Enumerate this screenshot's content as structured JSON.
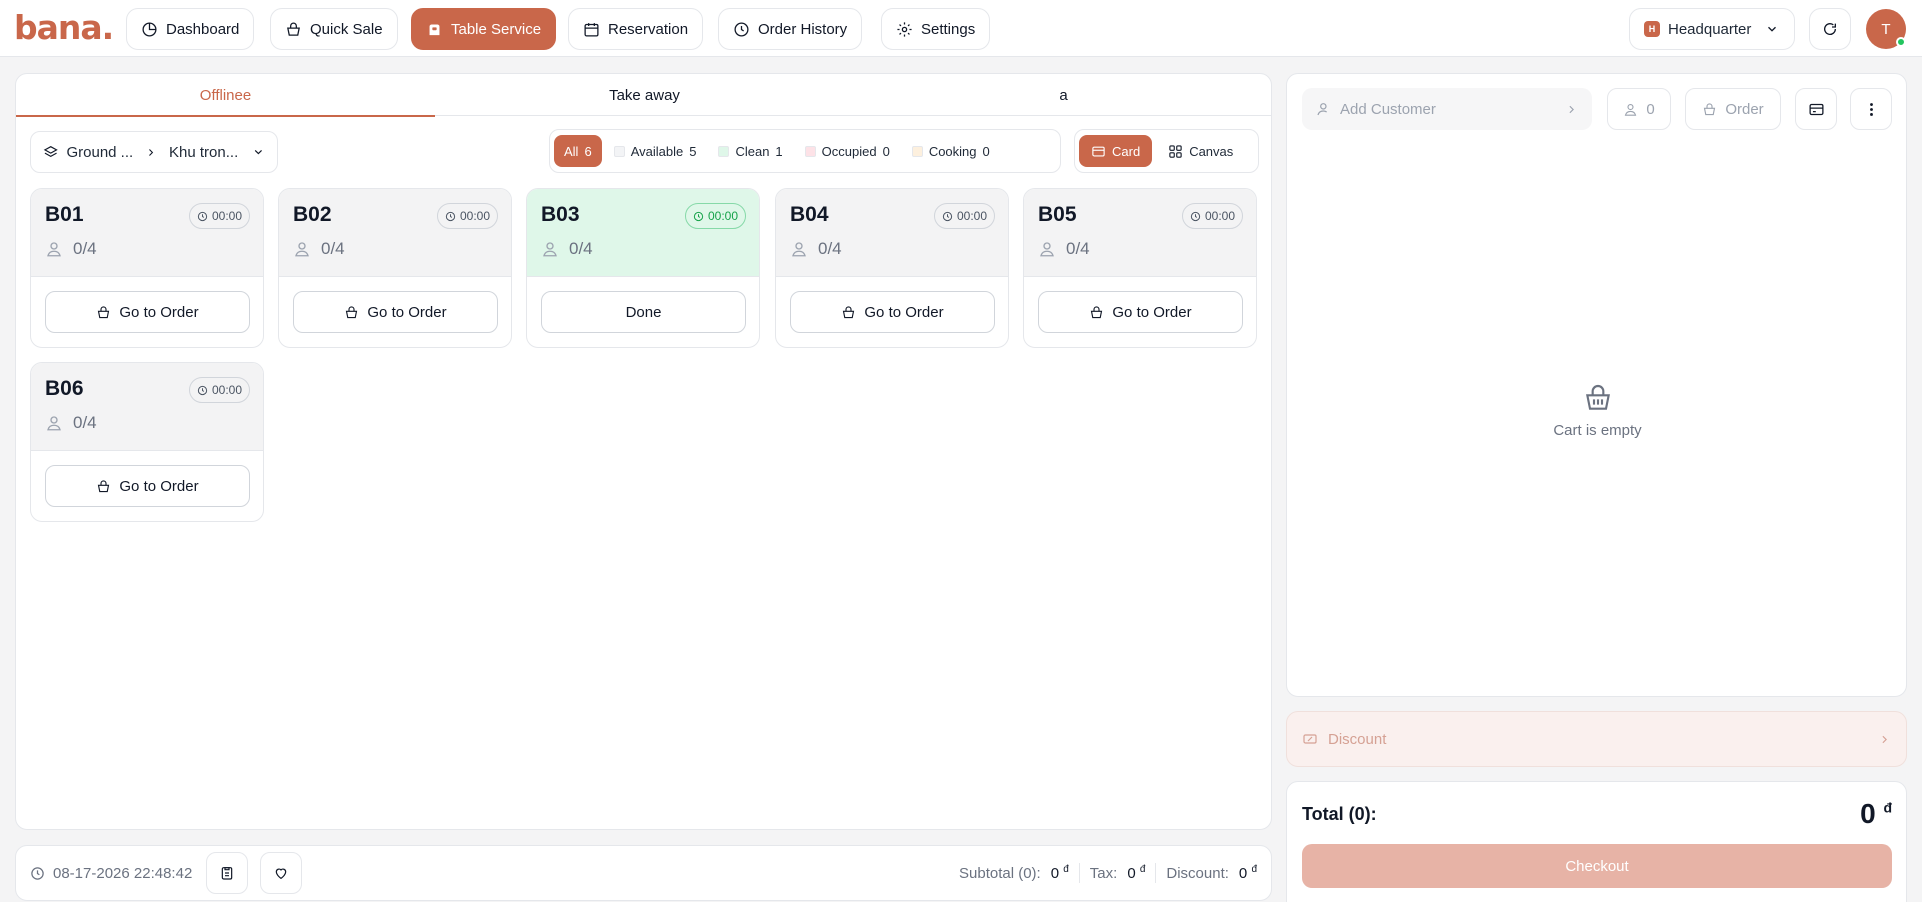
{
  "brand": {
    "logo_text": "bana",
    "accent": "#c9674a"
  },
  "nav": {
    "items": [
      {
        "label": "Dashboard",
        "icon": "dashboard-icon"
      },
      {
        "label": "Quick Sale",
        "icon": "basket-icon"
      },
      {
        "label": "Table Service",
        "icon": "table-service-icon",
        "active": true
      },
      {
        "label": "Reservation",
        "icon": "calendar-icon"
      },
      {
        "label": "Order History",
        "icon": "history-icon"
      },
      {
        "label": "Settings",
        "icon": "gear-icon"
      }
    ],
    "branch": {
      "badge": "H",
      "label": "Headquarter"
    },
    "avatar_initial": "T"
  },
  "tabs": [
    {
      "label": "Offlinee",
      "active": true
    },
    {
      "label": "Take away"
    },
    {
      "label": "a"
    }
  ],
  "floor": {
    "floor_label": "Ground ...",
    "area_label": "Khu tron..."
  },
  "filters": [
    {
      "label": "All",
      "count": "6",
      "active": true
    },
    {
      "label": "Available",
      "count": "5",
      "color": "#f3f4f6"
    },
    {
      "label": "Clean",
      "count": "1",
      "color": "#dff7e9"
    },
    {
      "label": "Occupied",
      "count": "0",
      "color": "#fde2e7"
    },
    {
      "label": "Cooking",
      "count": "0",
      "color": "#fdf0de"
    }
  ],
  "view_toggle": {
    "card_label": "Card",
    "canvas_label": "Canvas"
  },
  "tables": [
    {
      "name": "B01",
      "time": "00:00",
      "seats": "0/4",
      "action": "Go to Order",
      "status": "available"
    },
    {
      "name": "B02",
      "time": "00:00",
      "seats": "0/4",
      "action": "Go to Order",
      "status": "available"
    },
    {
      "name": "B03",
      "time": "00:00",
      "seats": "0/4",
      "action": "Done",
      "status": "clean"
    },
    {
      "name": "B04",
      "time": "00:00",
      "seats": "0/4",
      "action": "Go to Order",
      "status": "available"
    },
    {
      "name": "B05",
      "time": "00:00",
      "seats": "0/4",
      "action": "Go to Order",
      "status": "available"
    },
    {
      "name": "B06",
      "time": "00:00",
      "seats": "0/4",
      "action": "Go to Order",
      "status": "available"
    }
  ],
  "footer": {
    "datetime": "08-17-2026 22:48:42",
    "subtotal_label": "Subtotal (0):",
    "subtotal_value": "0",
    "tax_label": "Tax:",
    "tax_value": "0",
    "discount_label": "Discount:",
    "discount_value": "0",
    "currency": "đ"
  },
  "cart": {
    "add_customer": "Add Customer",
    "guests": "0",
    "order_label": "Order",
    "empty_text": "Cart is empty",
    "discount_label": "Discount",
    "total_label": "Total (0):",
    "total_value": "0",
    "currency": "đ",
    "checkout_label": "Checkout"
  }
}
